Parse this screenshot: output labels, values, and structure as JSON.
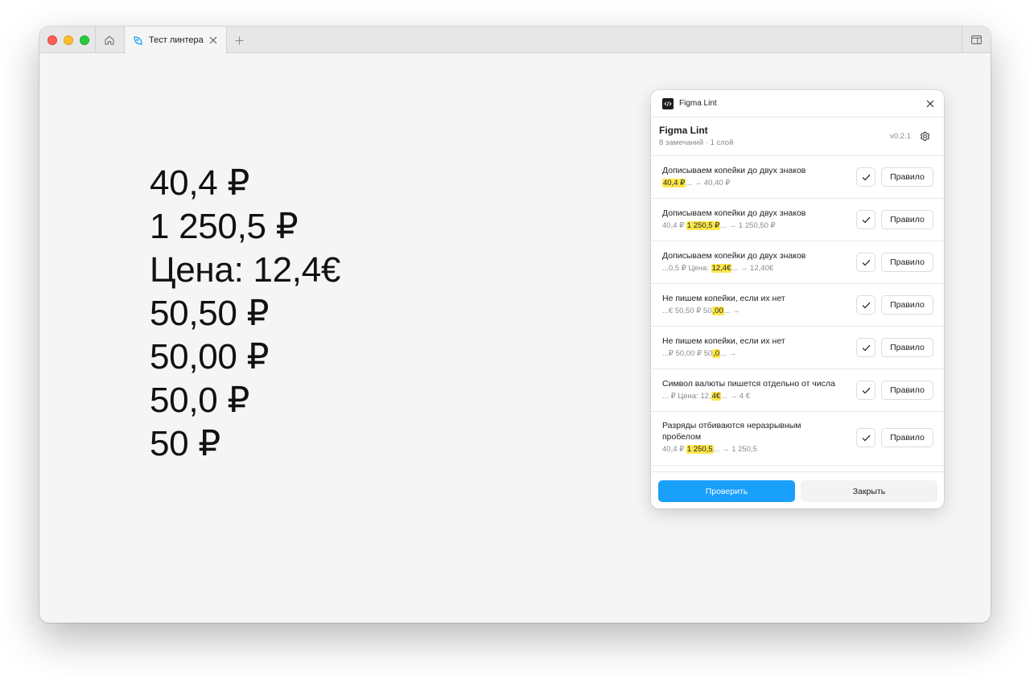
{
  "browser": {
    "tab_title": "Тест линтера",
    "icons": {
      "home": "home-icon",
      "tab": "figma-leaf-icon",
      "close": "close-icon",
      "new_tab": "plus-icon",
      "sidebar": "sidebar-toggle-icon"
    }
  },
  "canvas": {
    "lines": [
      "40,4 ₽",
      "1 250,5 ₽",
      "Цена: 12,4€",
      "50,50 ₽",
      "50,00 ₽",
      "50,0 ₽",
      "50 ₽"
    ]
  },
  "plugin": {
    "header_title": "Figma Lint",
    "name": "Figma Lint",
    "meta": "8 замечаний · 1 слой",
    "version": "v0.2.1",
    "accent_color": "#18a0fb",
    "highlight_color": "#fde74c",
    "issues": [
      {
        "title": "Дописываем копейки до двух знаков",
        "pre": "",
        "hl": "40,4 ₽",
        "post": "... → 40,40 ₽",
        "rule_label": "Правило"
      },
      {
        "title": "Дописываем копейки до двух знаков",
        "pre": "40,4 ₽ ",
        "hl": "1 250,5 ₽",
        "post": "... → 1 250,50 ₽",
        "rule_label": "Правило"
      },
      {
        "title": "Дописываем копейки до двух знаков",
        "pre": "...0,5 ₽ Цена: ",
        "hl": "12,4€",
        "post": "... → 12,40€",
        "rule_label": "Правило"
      },
      {
        "title": "Не пишем копейки, если их нет",
        "pre": "...€ 50,50 ₽ 50",
        "hl": ",00",
        "post": "... →",
        "rule_label": "Правило"
      },
      {
        "title": "Не пишем копейки, если их нет",
        "pre": "...₽ 50,00 ₽ 50",
        "hl": ",0",
        "post": "... →",
        "rule_label": "Правило"
      },
      {
        "title": "Символ валюты пишется отдельно от числа",
        "pre": "... ₽ Цена: 12,",
        "hl": "4€",
        "post": "... → 4 €",
        "rule_label": "Правило"
      },
      {
        "title": "Разряды отбиваются неразрывным пробелом",
        "pre": "40,4 ₽ ",
        "hl": "1 250,5",
        "post": "... → 1 250,5",
        "rule_label": "Правило"
      }
    ],
    "check_label": "Проверить",
    "close_label": "Закрыть"
  }
}
